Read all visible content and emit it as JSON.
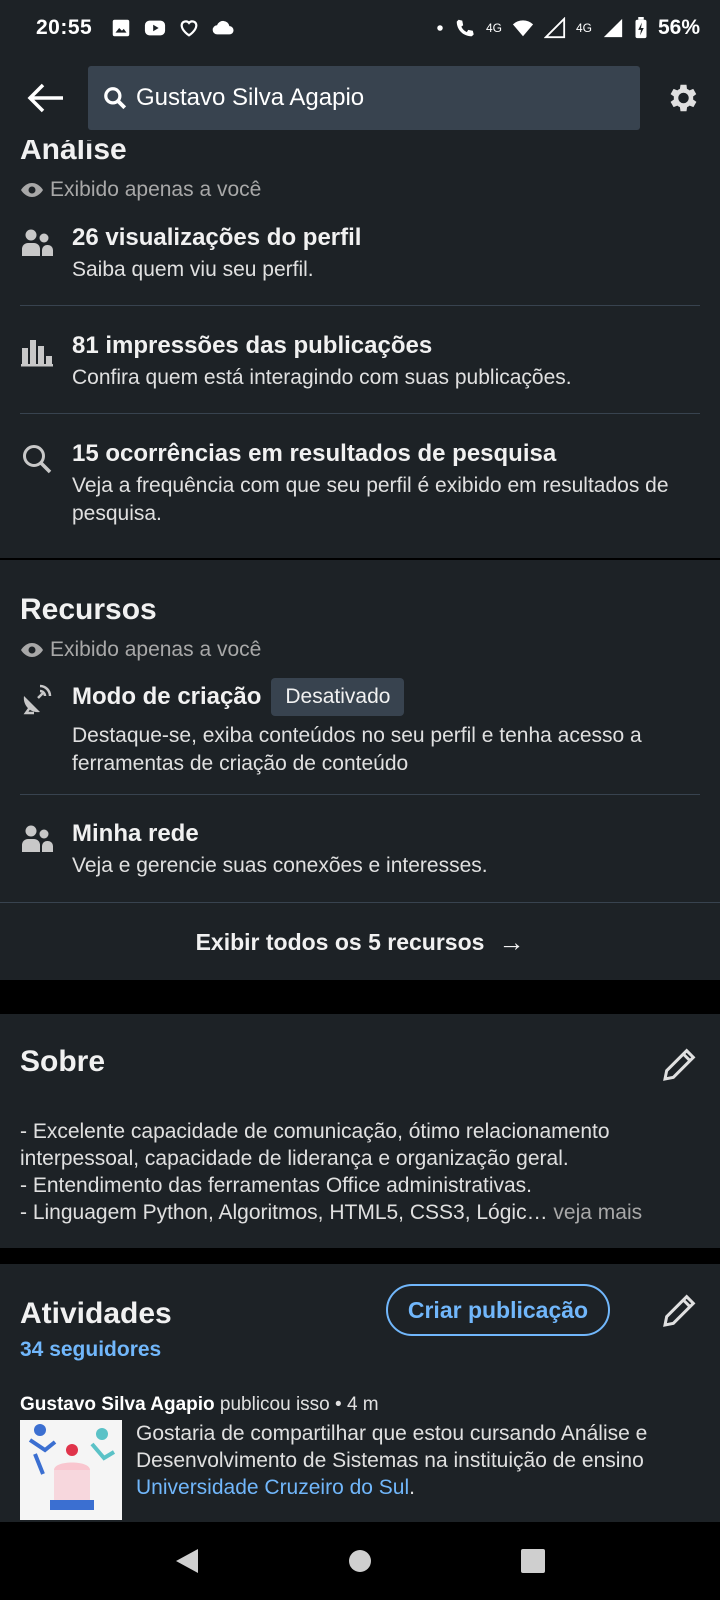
{
  "status": {
    "time": "20:55",
    "battery": "56%",
    "net_label_1": "4G",
    "net_label_2": "4G"
  },
  "header": {
    "search_value": "Gustavo Silva Agapio"
  },
  "analysis": {
    "title": "Análise",
    "visibility": "Exibido apenas a você",
    "items": [
      {
        "icon": "people-icon",
        "title": "26 visualizações do perfil",
        "subtitle": "Saiba quem viu seu perfil."
      },
      {
        "icon": "bar-chart-icon",
        "title": "81 impressões das publicações",
        "subtitle": "Confira quem está interagindo com suas publicações."
      },
      {
        "icon": "search-icon",
        "title": "15 ocorrências em resultados de pesquisa",
        "subtitle": "Veja a frequência com que seu perfil é exibido em resultados de pesquisa."
      }
    ]
  },
  "resources": {
    "title": "Recursos",
    "visibility": "Exibido apenas a você",
    "items": [
      {
        "icon": "satellite-dish-icon",
        "title": "Modo de criação",
        "badge": "Desativado",
        "subtitle": "Destaque-se, exiba conteúdos no seu perfil e tenha acesso a ferramentas de criação de conteúdo"
      },
      {
        "icon": "people-icon",
        "title": "Minha rede",
        "subtitle": "Veja e gerencie suas conexões e interesses."
      }
    ],
    "show_all": "Exibir todos os 5 recursos"
  },
  "about": {
    "title": "Sobre",
    "lines": [
      "- Excelente capacidade de comunicação, ótimo relacionamento interpessoal, capacidade de liderança e organização geral.",
      "- Entendimento das ferramentas Office administrativas.",
      "- Linguagem Python, Algoritmos, HTML5, CSS3, Lógic…"
    ],
    "see_more": "veja mais"
  },
  "activities": {
    "title": "Atividades",
    "create_button": "Criar publicação",
    "followers": "34 seguidores",
    "post": {
      "author": "Gustavo Silva Agapio",
      "action": "publicou isso • 4 m",
      "text_before": "Gostaria de compartilhar que estou cursando Análise e Desenvolvimento de Sistemas na instituição de ensino ",
      "link": "Universidade Cruzeiro do Sul",
      "text_after": "."
    }
  }
}
